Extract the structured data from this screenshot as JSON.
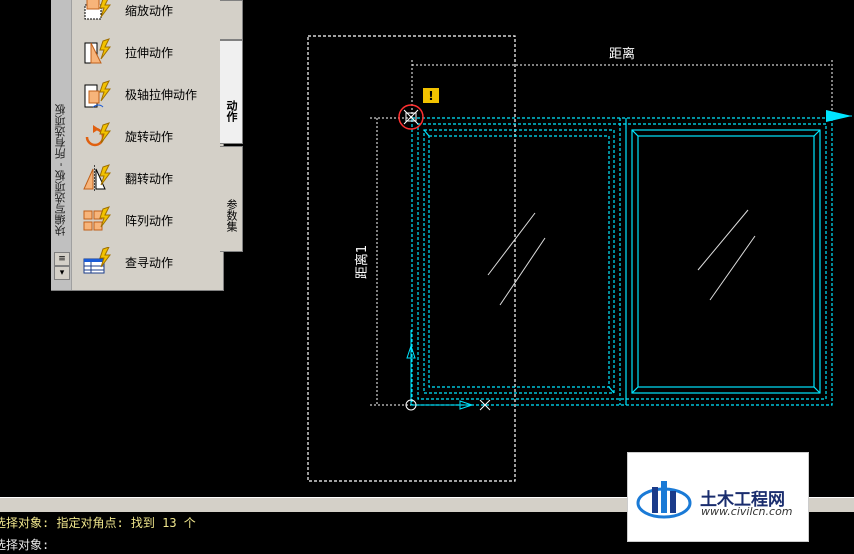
{
  "palette": {
    "title": "块编写选项板 - 所有选项板",
    "items": [
      {
        "label": "缩放动作",
        "icon": "scale-action-icon"
      },
      {
        "label": "拉伸动作",
        "icon": "stretch-action-icon"
      },
      {
        "label": "极轴拉伸动作",
        "icon": "polar-stretch-action-icon"
      },
      {
        "label": "旋转动作",
        "icon": "rotate-action-icon"
      },
      {
        "label": "翻转动作",
        "icon": "flip-action-icon"
      },
      {
        "label": "阵列动作",
        "icon": "array-action-icon"
      },
      {
        "label": "查寻动作",
        "icon": "lookup-action-icon"
      }
    ],
    "tabs": [
      {
        "label": "动作",
        "active": true
      },
      {
        "label": "参数集",
        "active": false
      }
    ]
  },
  "drawing": {
    "dimension_horizontal": "距离",
    "dimension_vertical": "距离1",
    "warning_marker": "!",
    "colors": {
      "geometry": "#00e5ff",
      "dimension": "#ffffff",
      "marker": "#ff3030",
      "warning": "#f2c200"
    }
  },
  "command_line": {
    "line1": "选择对象: 指定对角点: 找到 13 个",
    "line2": "选择对象:"
  },
  "watermark": {
    "name": "土木工程网",
    "url": "www.civilcn.com"
  }
}
